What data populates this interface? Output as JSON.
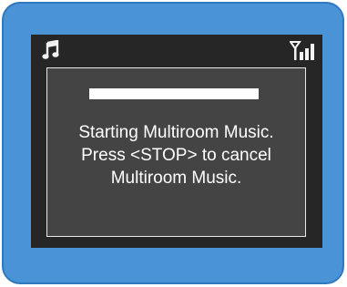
{
  "colors": {
    "frame": "#4a93d6",
    "screen": "#262626",
    "dialog": "#444444",
    "text": "#ffffff"
  },
  "status_bar": {
    "left_icon": "music-note-icon",
    "right_icon": "signal-strength-icon"
  },
  "dialog": {
    "progress": 1.0,
    "message_lines": [
      "Starting Multiroom Music.",
      "Press <STOP> to cancel",
      "Multiroom Music."
    ]
  }
}
